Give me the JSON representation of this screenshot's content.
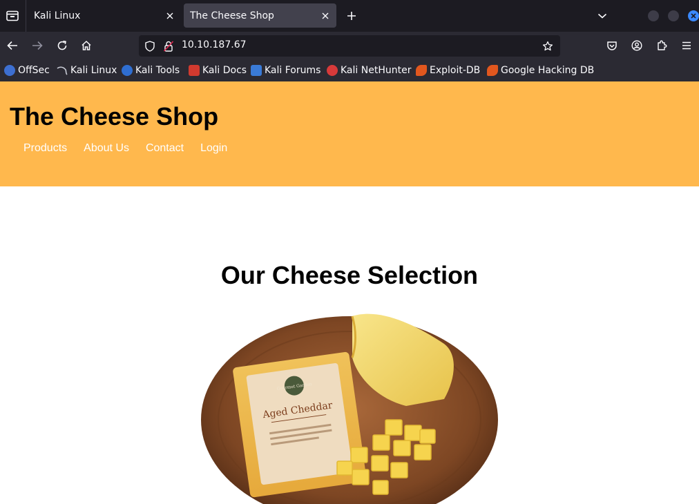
{
  "browser": {
    "tabs": [
      {
        "title": "Kali Linux",
        "active": false
      },
      {
        "title": "The Cheese Shop",
        "active": true
      }
    ],
    "url": "10.10.187.67",
    "bookmarks": [
      {
        "label": "OffSec",
        "color": "#3d6fd1"
      },
      {
        "label": "Kali Linux",
        "color": "#9aa3b5"
      },
      {
        "label": "Kali Tools",
        "color": "#2f6ed1"
      },
      {
        "label": "Kali Docs",
        "color": "#d13a2f"
      },
      {
        "label": "Kali Forums",
        "color": "#3a7bd8"
      },
      {
        "label": "Kali NetHunter",
        "color": "#d83a3a"
      },
      {
        "label": "Exploit-DB",
        "color": "#e2571e"
      },
      {
        "label": "Google Hacking DB",
        "color": "#e2571e"
      }
    ]
  },
  "site": {
    "title": "The Cheese Shop",
    "nav": [
      "Products",
      "About Us",
      "Contact",
      "Login"
    ],
    "section_title": "Our Cheese Selection",
    "product_image": {
      "package_label": "Aged Cheddar",
      "brand": "Gourmet Garden"
    },
    "header_color": "#ffb84d"
  }
}
